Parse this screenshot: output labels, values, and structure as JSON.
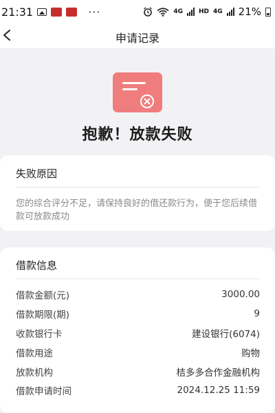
{
  "status_bar": {
    "time": "21:31",
    "dots": "···",
    "net_small": "4G",
    "hd": "HD",
    "net_small2": "4G",
    "battery_percent": "21%"
  },
  "nav": {
    "title": "申请记录"
  },
  "result": {
    "title": "抱歉！放款失败",
    "icon_color": "#f07d7d"
  },
  "reason_card": {
    "header": "失败原因",
    "text": "您的综合评分不足，请保持良好的借还款行为，便于您后续借款可放款成功"
  },
  "loan_card": {
    "header": "借款信息",
    "rows": [
      {
        "label": "借款金额(元)",
        "value": "3000.00"
      },
      {
        "label": "借款期限(期)",
        "value": "9"
      },
      {
        "label": "收款银行卡",
        "value": "建设银行(6074)"
      },
      {
        "label": "借款用途",
        "value": "购物"
      },
      {
        "label": "放款机构",
        "value": "桔多多合作金融机构"
      },
      {
        "label": "借款申请时间",
        "value": "2024.12.25 11:59"
      }
    ]
  }
}
